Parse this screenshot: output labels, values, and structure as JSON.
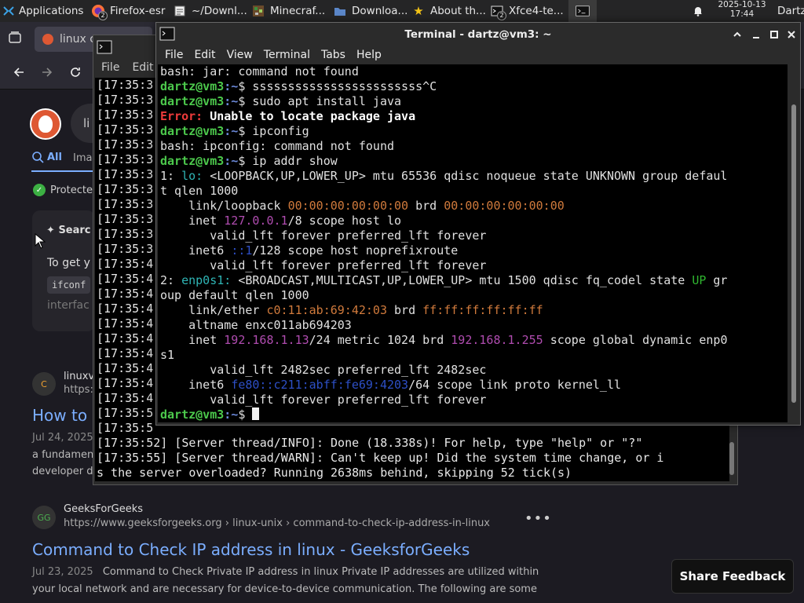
{
  "panel": {
    "app_menu": "Applications",
    "tasks": [
      {
        "label": "Firefox-esr",
        "badge": "2"
      },
      {
        "label": "~/Downl..."
      },
      {
        "label": "Minecraf..."
      },
      {
        "label": "Downloa..."
      },
      {
        "label": "About th..."
      },
      {
        "label": "Xfce4-te...",
        "badge": "2"
      }
    ],
    "date": "2025-10-13",
    "time": "17:44",
    "user": "Dartz"
  },
  "browser": {
    "tab_label": "linux c...",
    "search_text": "li",
    "tab_all": "All",
    "tab_images": "Ima",
    "protected": "Protecte",
    "assist_search": "Searc",
    "assist_text": "To get y",
    "assist_code": "ifconf",
    "assist_more": "interfac",
    "result1": {
      "site": "linuxv",
      "url": "https:/",
      "title": "How to",
      "date": "Jul 24, 2025",
      "desc1": "a fundamen",
      "desc2": "developer d"
    },
    "result2": {
      "site": "GeeksForGeeks",
      "url": "https://www.geeksforgeeks.org › linux-unix › command-to-check-ip-address-in-linux",
      "title": "Command to Check IP address in linux - GeeksforGeeks",
      "date": "Jul 23, 2025",
      "desc1": "Command to Check Private IP address in linux Private IP addresses are utilized within",
      "desc2": "your local network and are necessary for device-to-device communication. The following are some"
    },
    "feedback": "Share Feedback"
  },
  "term_back": {
    "menu": [
      "File",
      "Edit"
    ],
    "prefixes": [
      "[17:35:3",
      "[17:35:3",
      "[17:35:3",
      "[17:35:3",
      "[17:35:3",
      "[17:35:3",
      "[17:35:3",
      "[17:35:3",
      "[17:35:3",
      "[17:35:3",
      "[17:35:3",
      "[17:35:3",
      "[17:35:4",
      "[17:35:4",
      "[17:35:4",
      "[17:35:4",
      "[17:35:4",
      "[17:35:4",
      "[17:35:4",
      "[17:35:4",
      "[17:35:4",
      "[17:35:4",
      "[17:35:5",
      "[17:35:5"
    ],
    "line1": "[17:35:52] [Server thread/INFO]: Done (18.338s)! For help, type \"help\" or \"?\"",
    "line2": "[17:35:55] [Server thread/WARN]: Can't keep up! Did the system time change, or i",
    "line3": "s the server overloaded? Running 2638ms behind, skipping 52 tick(s)"
  },
  "term_front": {
    "title": "Terminal - dartz@vm3: ~",
    "menu": [
      "File",
      "Edit",
      "View",
      "Terminal",
      "Tabs",
      "Help"
    ],
    "prompt_user": "dartz@vm3",
    "prompt_path": ":~",
    "l1": "bash: jar: command not found",
    "cmd2": "$ ssssssssssssssssssssssss^C",
    "cmd3": "$ sudo apt install java",
    "err_label": "Error:",
    "err_msg": "Unable to locate package java",
    "cmd5": "$ ipconfig",
    "l6": "bash: ipconfig: command not found",
    "cmd7": "$ ip addr show",
    "lo_a": "1: ",
    "lo_name": "lo:",
    "lo_b": " <LOOPBACK,UP,LOWER_UP> mtu 65536 qdisc noqueue state UNKNOWN group defaul",
    "lo_c": "t qlen 1000",
    "lo_link_a": "    link/loopback ",
    "lo_mac": "00:00:00:00:00:00",
    "lo_brd": " brd ",
    "lo_brdmac": "00:00:00:00:00:00",
    "lo_inet_a": "    inet ",
    "lo_ip": "127.0.0.1",
    "lo_inet_b": "/8 scope host lo",
    "valid1": "       valid_lft forever preferred_lft forever",
    "lo_inet6_a": "    inet6 ",
    "lo_ip6": "::1",
    "lo_inet6_b": "/128 scope host noprefixroute",
    "valid2": "       valid_lft forever preferred_lft forever",
    "en_a": "2: ",
    "en_name": "enp0s1:",
    "en_b": " <BROADCAST,MULTICAST,UP,LOWER_UP> mtu 1500 qdisc fq_codel state ",
    "en_up": "UP",
    "en_c": " gr",
    "en_d": "oup default qlen 1000",
    "en_link_a": "    link/ether ",
    "en_mac": "c0:11:ab:69:42:03",
    "en_brd": " brd ",
    "en_brdmac": "ff:ff:ff:ff:ff:ff",
    "en_alt": "    altname enxc011ab694203",
    "en_inet_a": "    inet ",
    "en_ip": "192.168.1.13",
    "en_inet_b": "/24 metric 1024 brd ",
    "en_bcast": "192.168.1.255",
    "en_inet_c": " scope global dynamic enp0",
    "en_inet_d": "s1",
    "valid3": "       valid_lft 2482sec preferred_lft 2482sec",
    "en_inet6_a": "    inet6 ",
    "en_ip6": "fe80::c211:abff:fe69:4203",
    "en_inet6_b": "/64 scope link proto kernel_ll",
    "valid4": "       valid_lft forever preferred_lft forever",
    "final_prompt": "$ "
  }
}
